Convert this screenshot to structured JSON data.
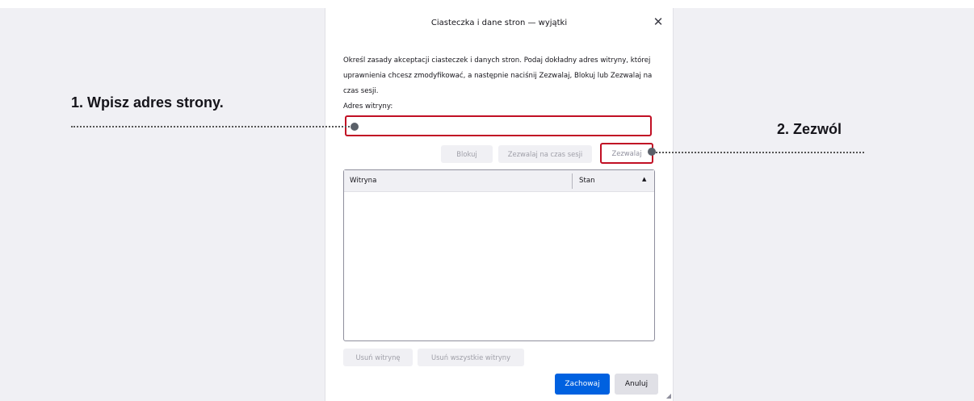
{
  "dialog": {
    "title": "Ciasteczka i dane stron — wyjątki",
    "close_icon": "close-icon",
    "description": "Określ zasady akceptacji ciasteczek i danych stron. Podaj dokładny adres witryny, której uprawnienia chcesz zmodyfikować, a następnie naciśnij Zezwalaj, Blokuj lub Zezwalaj na czas sesji.",
    "address_label": "Adres witryny:",
    "address_value": "",
    "buttons": {
      "block": "Blokuj",
      "allow_session": "Zezwalaj na czas sesji",
      "allow": "Zezwalaj",
      "remove_site": "Usuń witrynę",
      "remove_all": "Usuń wszystkie witryny",
      "save": "Zachowaj",
      "cancel": "Anuluj"
    },
    "table": {
      "columns": [
        "Witryna",
        "Stan"
      ],
      "sort_icon": "sort-up-icon",
      "rows": []
    }
  },
  "callouts": {
    "step1": "1. Wpisz adres strony.",
    "step2": "2. Zezwól"
  },
  "colors": {
    "highlight": "#c10f24",
    "primary_button": "#0061e0",
    "page_background": "#f0f0f4"
  }
}
